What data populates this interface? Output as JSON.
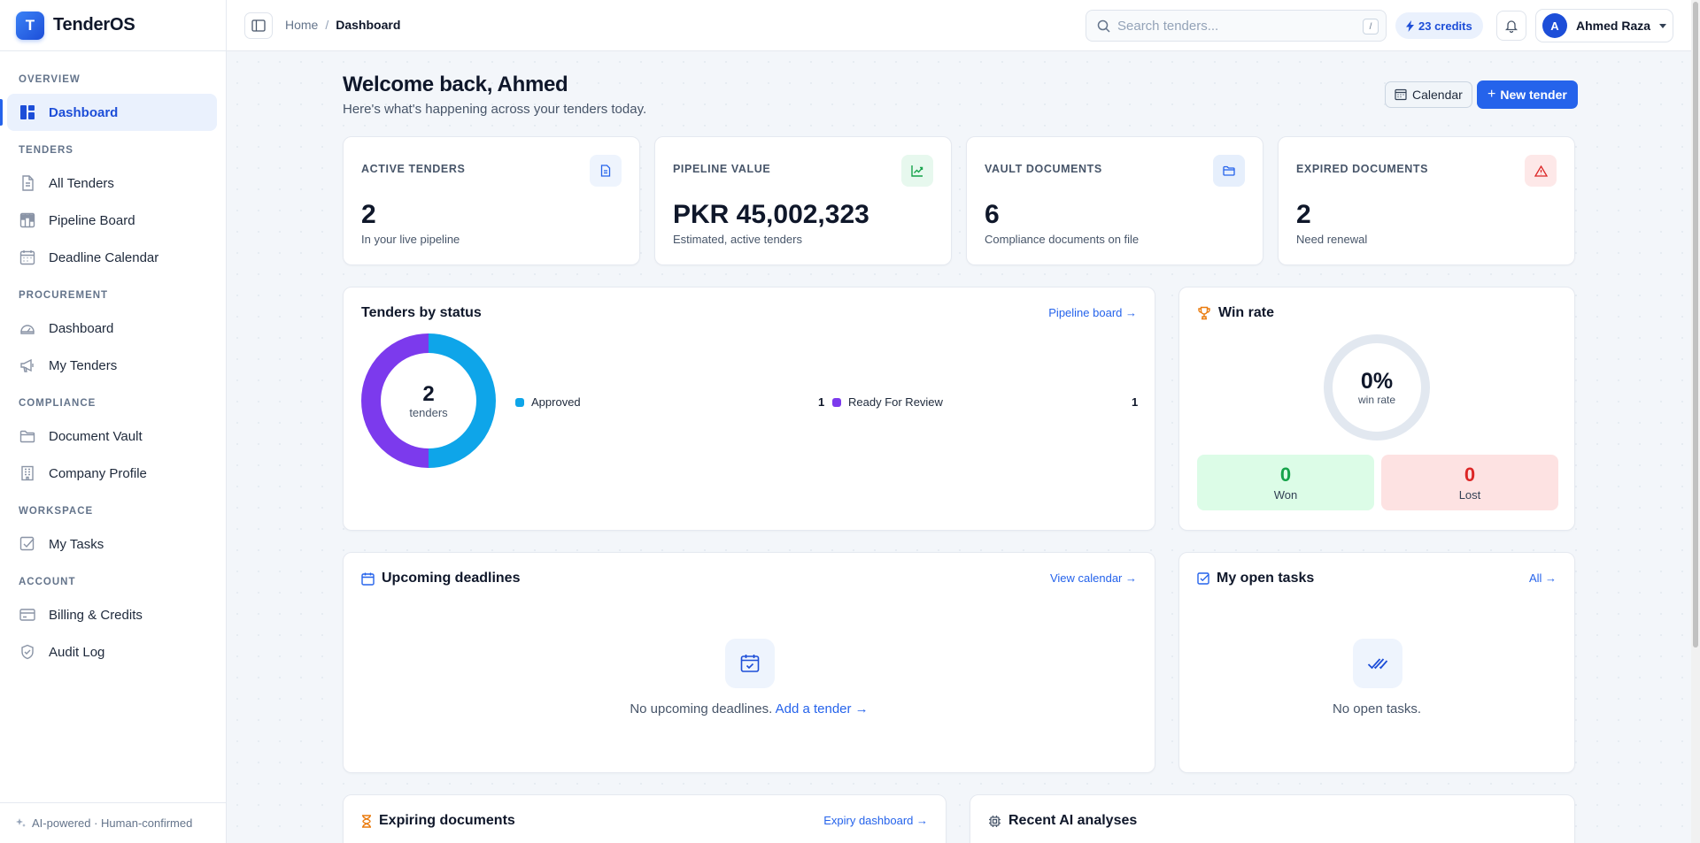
{
  "brand": {
    "logo_letter": "T",
    "name": "TenderOS"
  },
  "sidebar": {
    "sections": [
      {
        "title": "OVERVIEW",
        "items": [
          {
            "label": "Dashboard",
            "icon": "dashboard-icon",
            "active": true
          }
        ]
      },
      {
        "title": "TENDERS",
        "items": [
          {
            "label": "All Tenders",
            "icon": "file-icon"
          },
          {
            "label": "Pipeline Board",
            "icon": "kanban-icon"
          },
          {
            "label": "Deadline Calendar",
            "icon": "calendar-icon"
          }
        ]
      },
      {
        "title": "PROCUREMENT",
        "items": [
          {
            "label": "Dashboard",
            "icon": "gauge-icon"
          },
          {
            "label": "My Tenders",
            "icon": "megaphone-icon"
          }
        ]
      },
      {
        "title": "COMPLIANCE",
        "items": [
          {
            "label": "Document Vault",
            "icon": "folder-icon"
          },
          {
            "label": "Company Profile",
            "icon": "building-icon"
          }
        ]
      },
      {
        "title": "WORKSPACE",
        "items": [
          {
            "label": "My Tasks",
            "icon": "checkbox-icon"
          }
        ]
      },
      {
        "title": "ACCOUNT",
        "items": [
          {
            "label": "Billing & Credits",
            "icon": "credit-card-icon"
          },
          {
            "label": "Audit Log",
            "icon": "shield-icon"
          }
        ]
      }
    ],
    "footer": "AI-powered · Human-confirmed"
  },
  "topbar": {
    "breadcrumb": {
      "home": "Home",
      "separator": "/",
      "current": "Dashboard"
    },
    "search": {
      "placeholder": "Search tenders...",
      "value": "",
      "shortcut": "/"
    },
    "credits": "23 credits",
    "user": {
      "initial": "A",
      "name": "Ahmed Raza"
    }
  },
  "header": {
    "title": "Welcome back, Ahmed",
    "subtitle": "Here's what's happening across your tenders today.",
    "calendar_button": "Calendar",
    "new_button": "New tender"
  },
  "stats": [
    {
      "label": "ACTIVE TENDERS",
      "value": "2",
      "desc": "In your live pipeline",
      "icon": "document-icon",
      "color": "#2563eb",
      "bg": "#eef4fd"
    },
    {
      "label": "PIPELINE VALUE",
      "value": "PKR 45,002,323",
      "desc": "Estimated, active tenders",
      "icon": "trending-up-icon",
      "color": "#16a34a",
      "bg": "#e7f8ee"
    },
    {
      "label": "VAULT DOCUMENTS",
      "value": "6",
      "desc": "Compliance documents on file",
      "icon": "folder-icon",
      "color": "#2563eb",
      "bg": "#e6effc"
    },
    {
      "label": "EXPIRED DOCUMENTS",
      "value": "2",
      "desc": "Need renewal",
      "icon": "alert-triangle-icon",
      "color": "#dc2626",
      "bg": "#fde8e8"
    }
  ],
  "status_card": {
    "title": "Tenders by status",
    "link": "Pipeline board →",
    "total": "2",
    "total_label": "tenders",
    "chart_data": {
      "type": "pie",
      "categories": [
        "Approved",
        "Ready For Review"
      ],
      "values": [
        1,
        1
      ],
      "colors": [
        "#0ea5e9",
        "#7c3aed"
      ]
    }
  },
  "win_rate": {
    "title": "Win rate",
    "icon": "trophy-icon",
    "percent": "0%",
    "percent_value": 0,
    "label": "win rate",
    "won": {
      "value": "0",
      "label": "Won"
    },
    "lost": {
      "value": "0",
      "label": "Lost"
    }
  },
  "deadlines": {
    "title": "Upcoming deadlines",
    "link": "View calendar →",
    "empty_text": "No upcoming deadlines.",
    "empty_link": "Add a tender →"
  },
  "tasks": {
    "title": "My open tasks",
    "link": "All →",
    "empty_text": "No open tasks."
  },
  "expiring": {
    "title": "Expiring documents",
    "link": "Expiry dashboard →"
  },
  "analyses": {
    "title": "Recent AI analyses"
  }
}
